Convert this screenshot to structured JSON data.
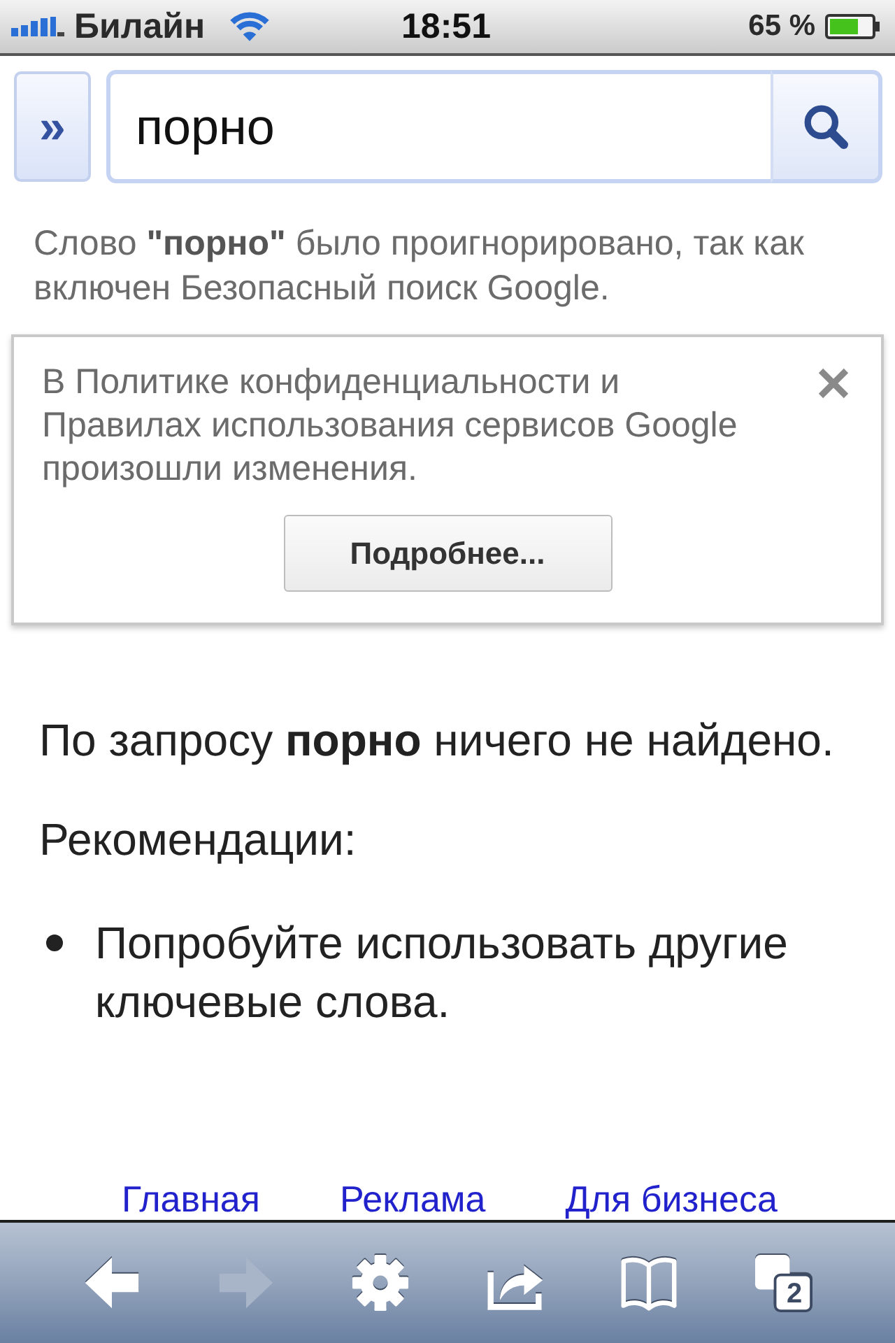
{
  "status_bar": {
    "carrier": "Билайн",
    "time": "18:51",
    "battery": "65 %"
  },
  "search": {
    "toggle_label": "»",
    "value": "порно"
  },
  "safe_search_notice": "Слово **\"порно\"** было проигнорировано, так как включен Безопасный поиск Google.",
  "policy_notice": {
    "text": "В Политике конфиденциальности и Правилах использования сервисов Google произошли изменения.",
    "button": "Подробнее..."
  },
  "results": {
    "message": "По запросу **порно** ничего не найдено.",
    "recommendations_heading": "Рекомендации:",
    "recommendations": [
      "Попробуйте использовать другие ключевые слова."
    ]
  },
  "footer_links": [
    "Главная",
    "Реклама",
    "Для бизнеса"
  ],
  "toolbar": [
    {
      "kind": "back",
      "disabled": false
    },
    {
      "kind": "forward",
      "disabled": true
    },
    {
      "kind": "settings",
      "disabled": false
    },
    {
      "kind": "share",
      "disabled": false
    },
    {
      "kind": "bookmarks",
      "disabled": false
    },
    {
      "kind": "tabs",
      "disabled": false,
      "badge": "2"
    }
  ]
}
